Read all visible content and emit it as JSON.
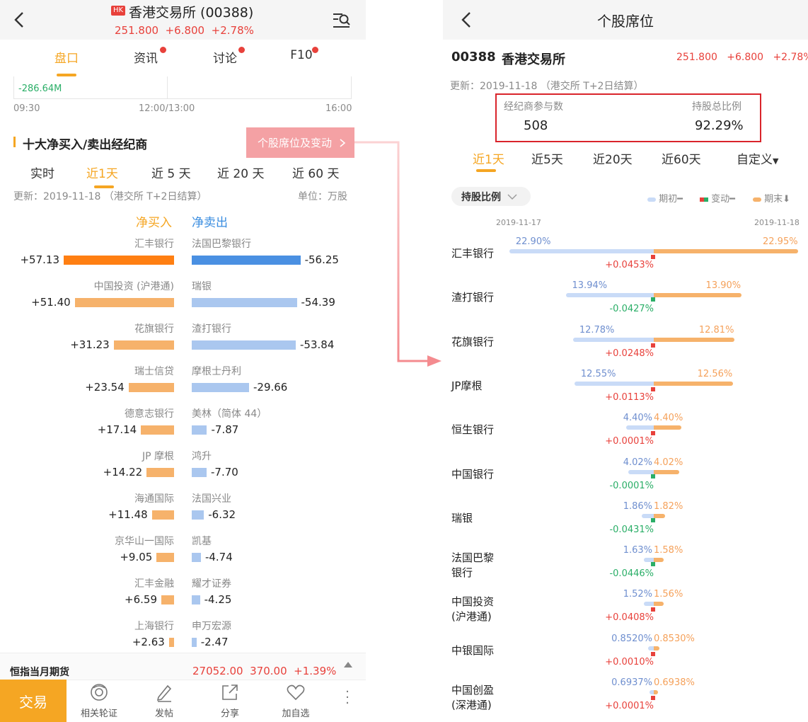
{
  "left": {
    "header": {
      "hk_badge": "HK",
      "title": "香港交易所 (00388)",
      "price": "251.800",
      "change": "+6.800",
      "change_pct": "+2.78%"
    },
    "tabs": [
      "盘口",
      "资讯",
      "讨论",
      "F10"
    ],
    "mini_chart": {
      "value_label": "-286.64M",
      "times": [
        "09:30",
        "12:00/13:00",
        "16:00"
      ]
    },
    "section_title": "十大净买入/卖出经纪商",
    "seat_button": "个股席位及变动",
    "period_tabs": [
      "实时",
      "近1天",
      "近 5 天",
      "近 20 天",
      "近 60 天"
    ],
    "update_text": "更新：2019-11-18 （港交所 T+2日结算）",
    "unit_text": "单位：万股",
    "col_buy": "净买入",
    "col_sell": "净卖出",
    "brokers": [
      {
        "buy_name": "汇丰银行",
        "buy_value": 57.13,
        "buy_label": "+57.13",
        "sell_name": "法国巴黎银行",
        "sell_value": 56.25,
        "sell_label": "-56.25"
      },
      {
        "buy_name": "中国投资 (沪港通)",
        "buy_value": 51.4,
        "buy_label": "+51.40",
        "sell_name": "瑞银",
        "sell_value": 54.39,
        "sell_label": "-54.39"
      },
      {
        "buy_name": "花旗银行",
        "buy_value": 31.23,
        "buy_label": "+31.23",
        "sell_name": "渣打银行",
        "sell_value": 53.84,
        "sell_label": "-53.84"
      },
      {
        "buy_name": "瑞士信贷",
        "buy_value": 23.54,
        "buy_label": "+23.54",
        "sell_name": "摩根士丹利",
        "sell_value": 29.66,
        "sell_label": "-29.66"
      },
      {
        "buy_name": "德意志银行",
        "buy_value": 17.14,
        "buy_label": "+17.14",
        "sell_name": "美林（简体 44）",
        "sell_value": 7.87,
        "sell_label": "-7.87"
      },
      {
        "buy_name": "JP 摩根",
        "buy_value": 14.22,
        "buy_label": "+14.22",
        "sell_name": "鸿升",
        "sell_value": 7.7,
        "sell_label": "-7.70"
      },
      {
        "buy_name": "海通国际",
        "buy_value": 11.48,
        "buy_label": "+11.48",
        "sell_name": "法国兴业",
        "sell_value": 6.32,
        "sell_label": "-6.32"
      },
      {
        "buy_name": "京华山一国际",
        "buy_value": 9.05,
        "buy_label": "+9.05",
        "sell_name": "凯基",
        "sell_value": 4.74,
        "sell_label": "-4.74"
      },
      {
        "buy_name": "汇丰金融",
        "buy_value": 6.59,
        "buy_label": "+6.59",
        "sell_name": "耀才证券",
        "sell_value": 4.25,
        "sell_label": "-4.25"
      },
      {
        "buy_name": "上海银行",
        "buy_value": 2.63,
        "buy_label": "+2.63",
        "sell_name": "申万宏源",
        "sell_value": 2.47,
        "sell_label": "-2.47"
      }
    ],
    "futures": {
      "name": "恒指当月期货",
      "price": "27052.00",
      "change": "370.00",
      "change_pct": "+1.39%"
    },
    "bottom_bar": {
      "trade": "交易",
      "items": [
        "相关轮证",
        "发帖",
        "分享",
        "加自选"
      ]
    }
  },
  "right": {
    "title": "个股席位",
    "stock_code": "00388",
    "stock_name": "香港交易所",
    "price": "251.800",
    "change": "+6.800",
    "change_pct": "+2.78%",
    "update_text": "更新：2019-11-18 （港交所 T+2日结算）",
    "broker_count_label": "经纪商参与数",
    "broker_count": "508",
    "ratio_label": "持股总比例",
    "ratio": "92.29%",
    "period_tabs": [
      "近1天",
      "近5天",
      "近20天",
      "近60天",
      "自定义"
    ],
    "dropdown": "持股比例",
    "legend": [
      "期初",
      "变动",
      "期末"
    ],
    "date_start": "2019-11-17",
    "date_end": "2019-11-18",
    "holdings": [
      {
        "name": [
          "汇丰银行"
        ],
        "start": 22.9,
        "start_label": "22.90%",
        "end": 22.95,
        "end_label": "22.95%",
        "change_label": "+0.0453%",
        "dir": "up"
      },
      {
        "name": [
          "渣打银行"
        ],
        "start": 13.94,
        "start_label": "13.94%",
        "end": 13.9,
        "end_label": "13.90%",
        "change_label": "-0.0427%",
        "dir": "down"
      },
      {
        "name": [
          "花旗银行"
        ],
        "start": 12.78,
        "start_label": "12.78%",
        "end": 12.81,
        "end_label": "12.81%",
        "change_label": "+0.0248%",
        "dir": "up"
      },
      {
        "name": [
          "JP摩根"
        ],
        "start": 12.55,
        "start_label": "12.55%",
        "end": 12.56,
        "end_label": "12.56%",
        "change_label": "+0.0113%",
        "dir": "up"
      },
      {
        "name": [
          "恒生银行"
        ],
        "start": 4.4,
        "start_label": "4.40%",
        "end": 4.4,
        "end_label": "4.40%",
        "change_label": "+0.0001%",
        "dir": "up"
      },
      {
        "name": [
          "中国银行"
        ],
        "start": 4.02,
        "start_label": "4.02%",
        "end": 4.02,
        "end_label": "4.02%",
        "change_label": "-0.0001%",
        "dir": "down"
      },
      {
        "name": [
          "瑞银"
        ],
        "start": 1.86,
        "start_label": "1.86%",
        "end": 1.82,
        "end_label": "1.82%",
        "change_label": "-0.0431%",
        "dir": "down"
      },
      {
        "name": [
          "法国巴黎",
          "银行"
        ],
        "start": 1.63,
        "start_label": "1.63%",
        "end": 1.58,
        "end_label": "1.58%",
        "change_label": "-0.0446%",
        "dir": "down"
      },
      {
        "name": [
          "中国投资",
          "(沪港通)"
        ],
        "start": 1.52,
        "start_label": "1.52%",
        "end": 1.56,
        "end_label": "1.56%",
        "change_label": "+0.0408%",
        "dir": "up"
      },
      {
        "name": [
          "中银国际"
        ],
        "start": 0.852,
        "start_label": "0.8520%",
        "end": 0.853,
        "end_label": "0.8530%",
        "change_label": "+0.0010%",
        "dir": "up"
      },
      {
        "name": [
          "中国创盈",
          "(深港通)"
        ],
        "start": 0.6937,
        "start_label": "0.6937%",
        "end": 0.6938,
        "end_label": "0.6938%",
        "change_label": "+0.0001%",
        "dir": "up"
      }
    ]
  },
  "colors": {
    "red": "#e8413b",
    "green": "#2aae67",
    "orange": "#f5a623",
    "buy_top": "#ff7f12",
    "buy": "#f6b26b",
    "sell_top": "#4a90e2",
    "sell": "#aac7ef",
    "start_bar": "#c9dbf7",
    "end_bar": "#f6b26b",
    "highlight_box": "#d9242b",
    "seat_button_bg": "#f4a1a4"
  }
}
